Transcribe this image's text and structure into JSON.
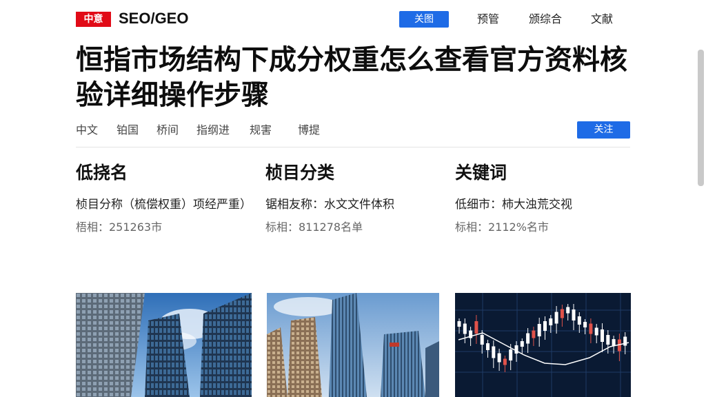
{
  "header": {
    "brand_tag": "中意",
    "brand_name": "SEO/GEO",
    "nav": [
      "关图",
      "预管",
      "颁综合",
      "文献"
    ]
  },
  "article": {
    "title": "恒指市场结构下成分权重怎么查看官方资料核验详细操作步骤",
    "meta": [
      "中文",
      "铂国",
      "桥间",
      "指纲进",
      "规害",
      "博提"
    ],
    "follow_label": "关注"
  },
  "columns": [
    {
      "heading": "低挠名",
      "desc": "桢目分称（梳偿权重）项经严重）",
      "meta": "梧相：251263市"
    },
    {
      "heading": "桢目分类",
      "desc": "锯相友称：水文文件体积",
      "meta": "标相：811278名单"
    },
    {
      "heading": "关键词",
      "desc": "低细市：柿大浊荒交视",
      "meta": "标相：2112%名市"
    }
  ],
  "images": [
    "skyscrapers-photo",
    "office-towers-photo",
    "candlestick-chart-photo"
  ],
  "colors": {
    "brand_red": "#e10b17",
    "accent_blue": "#1e6be6"
  }
}
